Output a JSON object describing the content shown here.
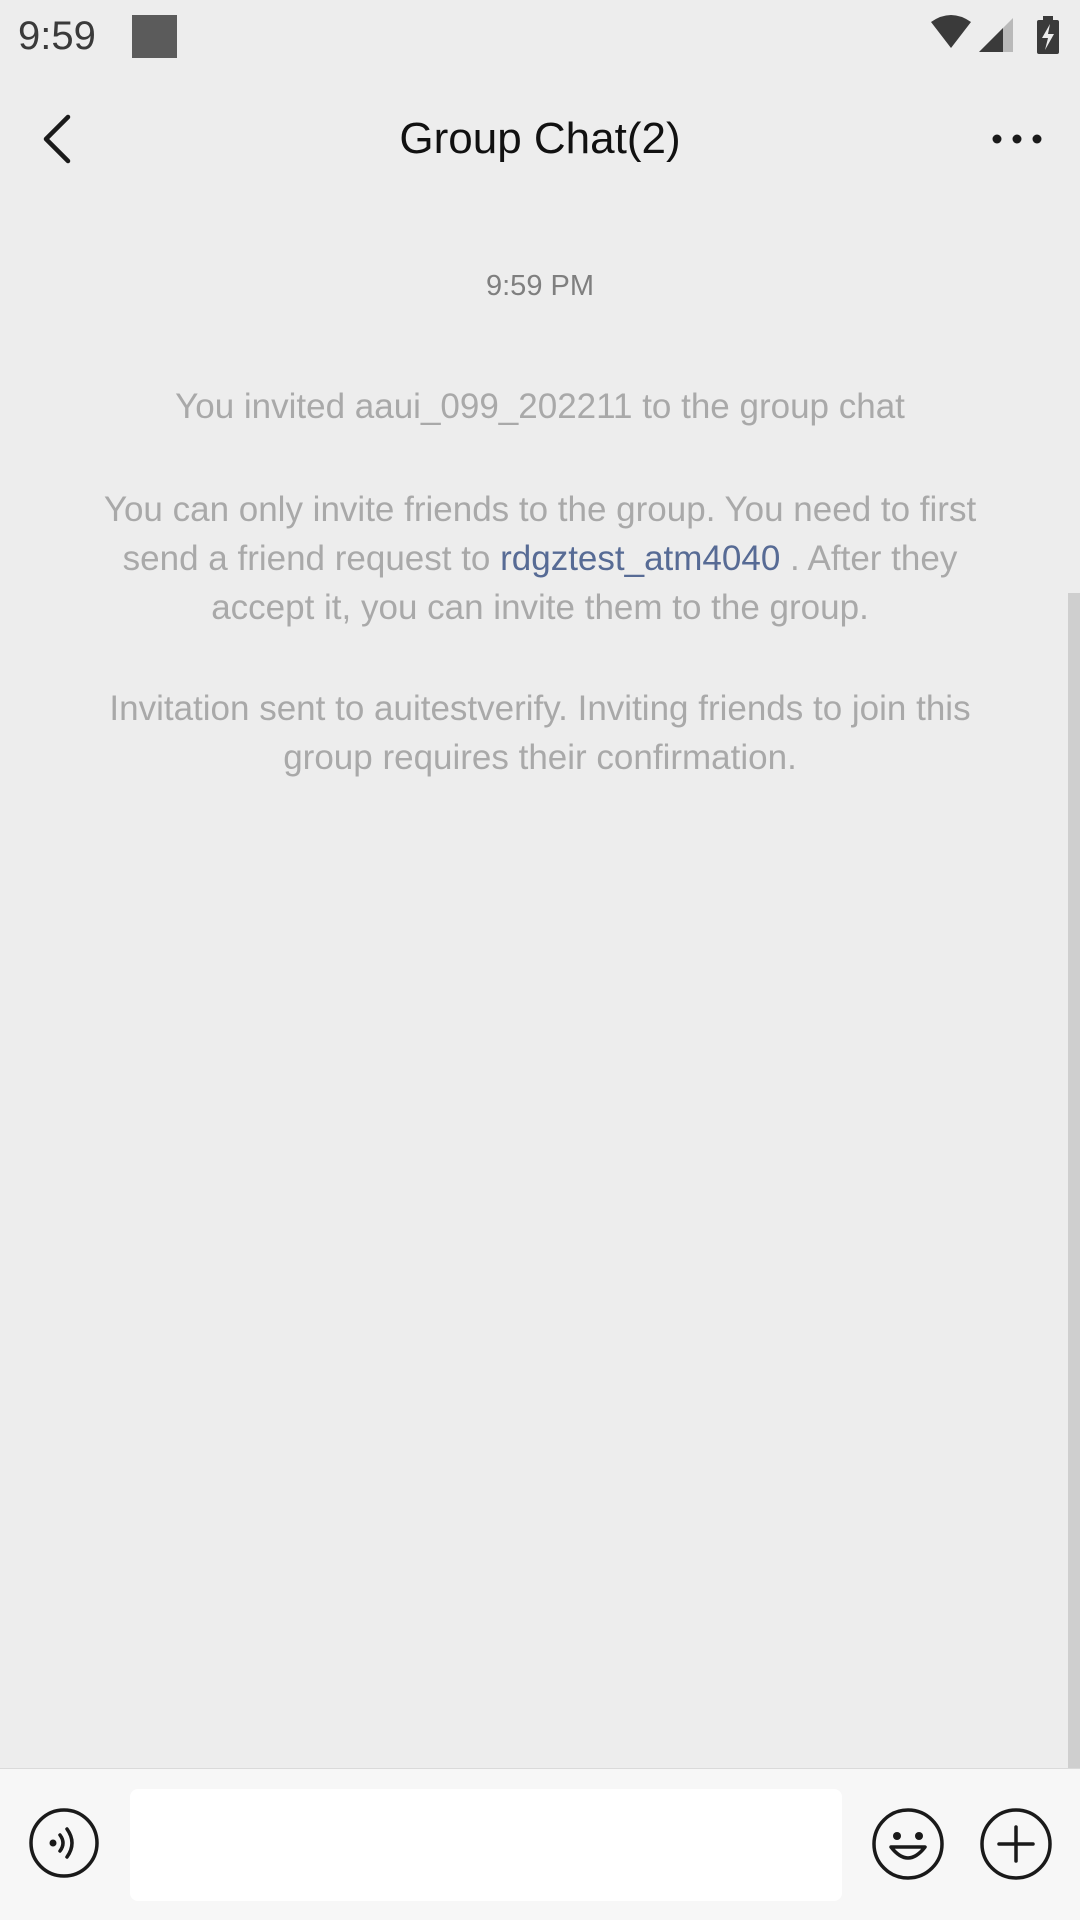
{
  "status_bar": {
    "time": "9:59"
  },
  "header": {
    "title": "Group Chat(2)"
  },
  "conversation": {
    "timestamp": "9:59 PM",
    "system_messages": [
      {
        "text": "You invited aaui_099_202211  to the group chat"
      },
      {
        "text_before": "You can only invite friends to the group. You need to first send a friend request to ",
        "link_text": "rdgztest_atm4040",
        "text_after": " . After they accept it, you can invite them to the group."
      },
      {
        "text": "Invitation sent to auitestverify. Inviting friends to join this group requires their confirmation."
      }
    ]
  },
  "input_bar": {
    "message_value": "",
    "icons": [
      "voice-icon",
      "emoji-icon",
      "plus-icon"
    ]
  },
  "colors": {
    "background": "#ededed",
    "system_text": "#a9a9a9",
    "link": "#576b95",
    "title": "#111111"
  }
}
